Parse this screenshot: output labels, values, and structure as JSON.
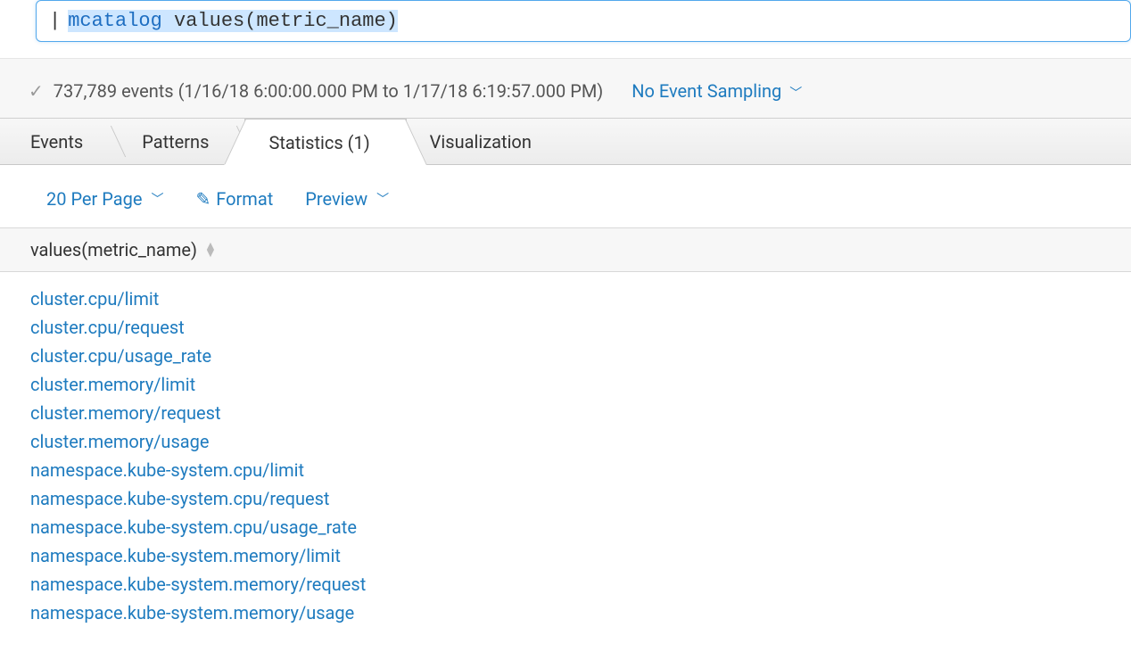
{
  "search": {
    "pipe": "|",
    "command": "mcatalog",
    "args": "values(metric_name)"
  },
  "status": {
    "events_text": "737,789 events (1/16/18 6:00:00.000 PM to 1/17/18 6:19:57.000 PM)",
    "sampling_label": "No Event Sampling"
  },
  "tabs": {
    "events": "Events",
    "patterns": "Patterns",
    "statistics": "Statistics (1)",
    "visualization": "Visualization"
  },
  "toolbar": {
    "per_page": "20 Per Page",
    "format": "Format",
    "preview": "Preview"
  },
  "table": {
    "column_header": "values(metric_name)",
    "rows": [
      "cluster.cpu/limit",
      "cluster.cpu/request",
      "cluster.cpu/usage_rate",
      "cluster.memory/limit",
      "cluster.memory/request",
      "cluster.memory/usage",
      "namespace.kube-system.cpu/limit",
      "namespace.kube-system.cpu/request",
      "namespace.kube-system.cpu/usage_rate",
      "namespace.kube-system.memory/limit",
      "namespace.kube-system.memory/request",
      "namespace.kube-system.memory/usage"
    ]
  }
}
